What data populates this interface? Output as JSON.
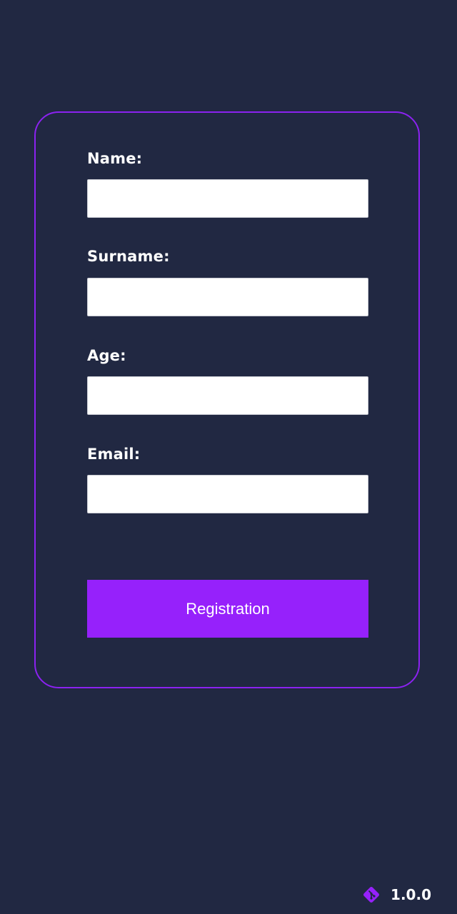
{
  "form": {
    "fields": [
      {
        "label": "Name:",
        "value": "",
        "placeholder": ""
      },
      {
        "label": "Surname:",
        "value": "",
        "placeholder": ""
      },
      {
        "label": "Age:",
        "value": "",
        "placeholder": ""
      },
      {
        "label": "Email:",
        "value": "",
        "placeholder": ""
      }
    ],
    "submit_label": "Registration"
  },
  "footer": {
    "icon": "git-icon",
    "version": "1.0.0"
  },
  "colors": {
    "background": "#212842",
    "accent": "#9621fb",
    "card_border": "#8b22f0"
  }
}
